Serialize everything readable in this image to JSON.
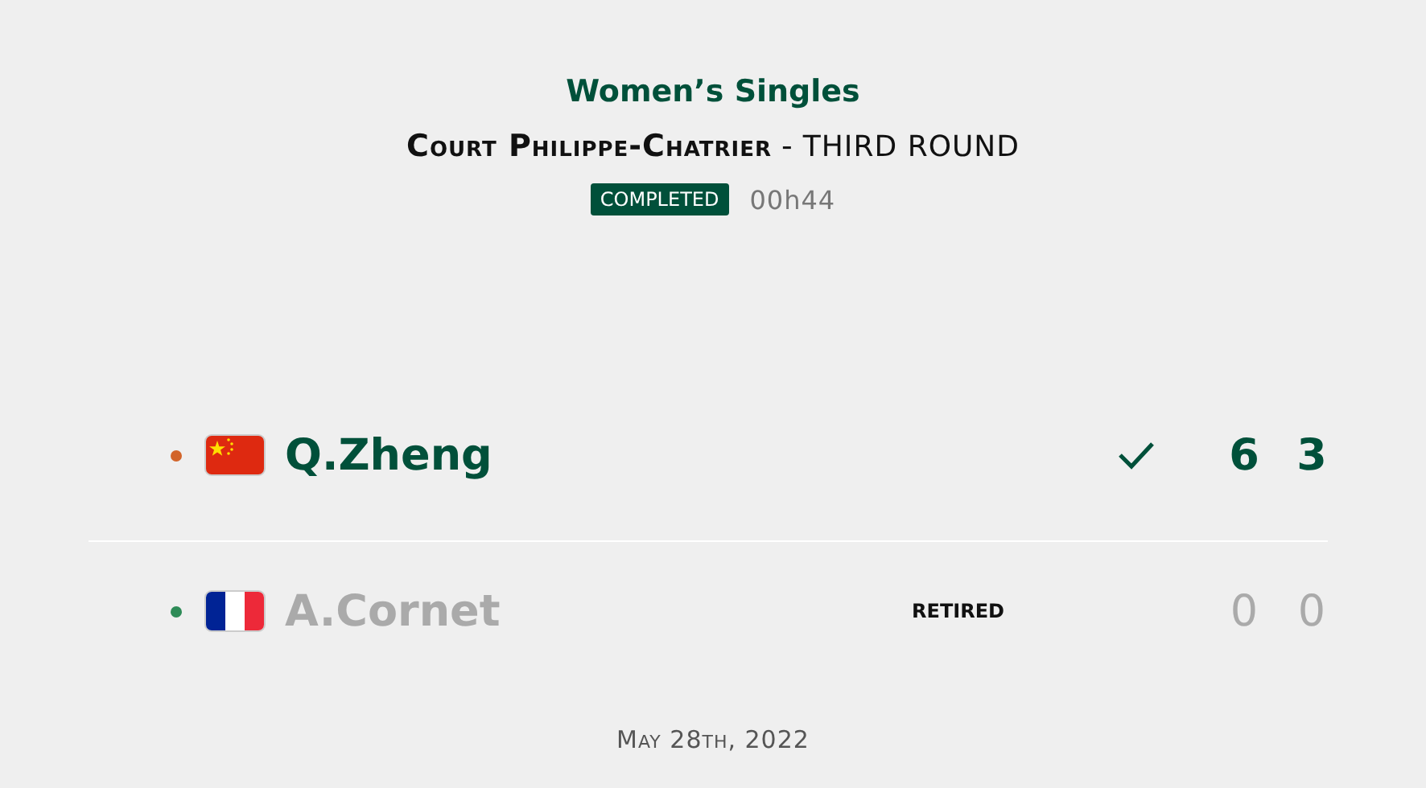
{
  "event": "Women’s Singles",
  "court": "Court Philippe-Chatrier",
  "separator": "-",
  "round": "THIRD ROUND",
  "status": "COMPLETED",
  "duration": "00h44",
  "players": [
    {
      "name": "Q.Zheng",
      "flag": {
        "kind": "cn"
      },
      "color": "#d2642a",
      "winner": true,
      "scores": [
        "6",
        "3"
      ]
    },
    {
      "name": "A.Cornet",
      "flag": {
        "kind": "fr"
      },
      "color": "#2e8b57",
      "winner": false,
      "note": "RETIRED",
      "scores": [
        "0",
        "0"
      ]
    }
  ],
  "date": "May 28th, 2022"
}
